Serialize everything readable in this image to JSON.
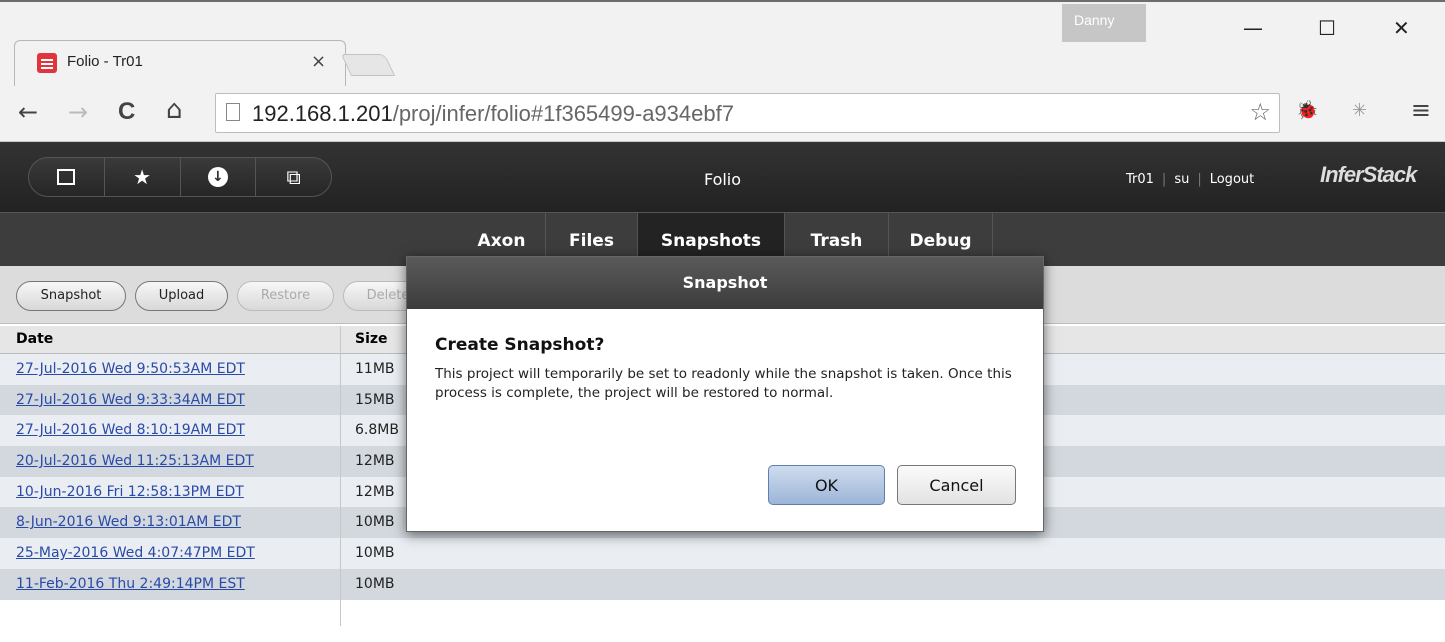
{
  "browser": {
    "tab_title": "Folio - Tr01",
    "tab_close": "×",
    "profile_name": "Danny",
    "window_controls": {
      "minimize": "—",
      "maximize": "☐",
      "close": "✕"
    },
    "nav": {
      "back": "←",
      "forward": "→",
      "reload": "C",
      "home": "⌂"
    },
    "url_host": "192.168.1.201",
    "url_path": "/proj/infer/folio#1f365499-a934ebf7",
    "bookmark_star": "☆",
    "extensions": [
      "bug-extension-icon",
      "snowflake-extension-icon"
    ],
    "menu_icon": "≡"
  },
  "app": {
    "title": "Folio",
    "icon_buttons": [
      "square-icon",
      "star-icon",
      "download-icon",
      "windows-icon"
    ],
    "user": {
      "project": "Tr01",
      "role": "su",
      "logout": "Logout"
    },
    "brand": "InferStack"
  },
  "tabs": [
    {
      "label": "Axon",
      "active": false
    },
    {
      "label": "Files",
      "active": false
    },
    {
      "label": "Snapshots",
      "active": true
    },
    {
      "label": "Trash",
      "active": false
    },
    {
      "label": "Debug",
      "active": false
    }
  ],
  "actions": {
    "snapshot": "Snapshot",
    "upload": "Upload",
    "restore": "Restore",
    "delete": "Delete"
  },
  "table": {
    "headers": {
      "date": "Date",
      "size": "Size"
    },
    "rows": [
      {
        "date": "27-Jul-2016 Wed 9:50:53AM EDT",
        "size": "11MB"
      },
      {
        "date": "27-Jul-2016 Wed 9:33:34AM EDT",
        "size": "15MB"
      },
      {
        "date": "27-Jul-2016 Wed 8:10:19AM EDT",
        "size": "6.8MB"
      },
      {
        "date": "20-Jul-2016 Wed 11:25:13AM EDT",
        "size": "12MB"
      },
      {
        "date": "10-Jun-2016 Fri 12:58:13PM EDT",
        "size": "12MB"
      },
      {
        "date": "8-Jun-2016 Wed 9:13:01AM EDT",
        "size": "10MB"
      },
      {
        "date": "25-May-2016 Wed 4:07:47PM EDT",
        "size": "10MB"
      },
      {
        "date": "11-Feb-2016 Thu 2:49:14PM EST",
        "size": "10MB"
      }
    ]
  },
  "dialog": {
    "header": "Snapshot",
    "title": "Create Snapshot?",
    "message": "This project will temporarily be set to readonly while the snapshot is taken. Once this process is complete, the project will be restored to normal.",
    "ok": "OK",
    "cancel": "Cancel"
  }
}
